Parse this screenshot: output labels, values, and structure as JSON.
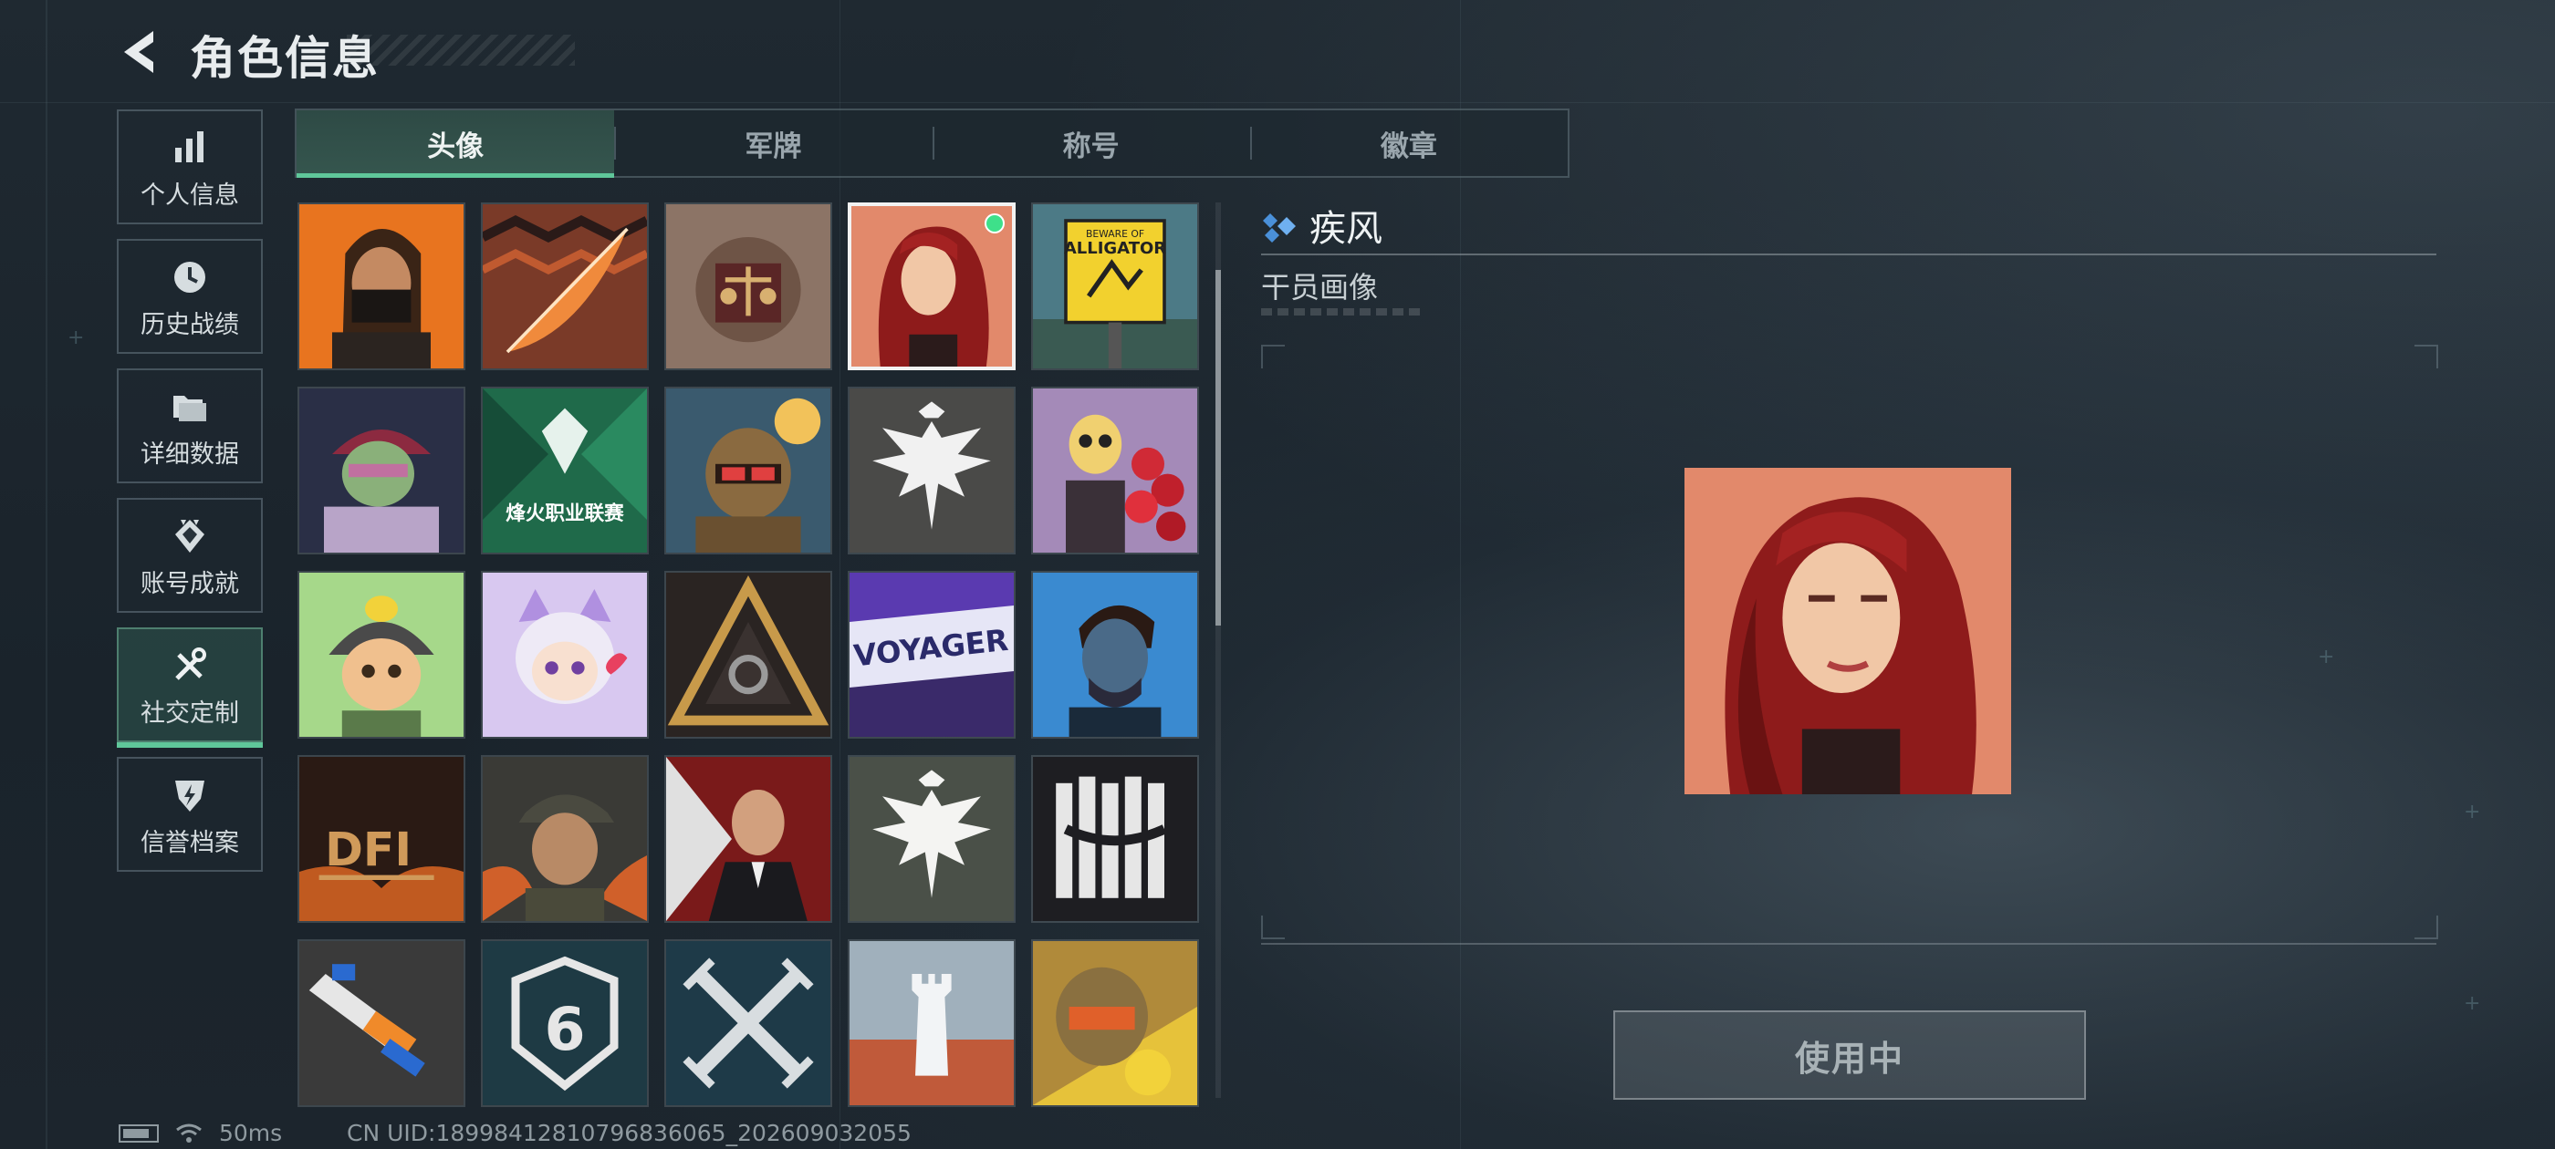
{
  "header": {
    "title": "角色信息"
  },
  "sidebar": {
    "items": [
      {
        "label": "个人信息",
        "icon": "bar-chart-icon",
        "active": false
      },
      {
        "label": "历史战绩",
        "icon": "clock-icon",
        "active": false
      },
      {
        "label": "详细数据",
        "icon": "folder-icon",
        "active": false
      },
      {
        "label": "账号成就",
        "icon": "badge-icon",
        "active": false
      },
      {
        "label": "社交定制",
        "icon": "tools-icon",
        "active": true
      },
      {
        "label": "信誉档案",
        "icon": "shield-bolt-icon",
        "active": false
      }
    ]
  },
  "tabs": [
    {
      "label": "头像",
      "active": true
    },
    {
      "label": "军牌",
      "active": false
    },
    {
      "label": "称号",
      "active": false
    },
    {
      "label": "徽章",
      "active": false
    }
  ],
  "avatars": [
    {
      "name": "masked-man-avatar",
      "text": ""
    },
    {
      "name": "feather-avatar",
      "text": ""
    },
    {
      "name": "scales-emblem-avatar",
      "text": ""
    },
    {
      "name": "red-hair-woman-avatar",
      "text": "",
      "selected": true
    },
    {
      "name": "beware-alligator-avatar",
      "text": "BEWARE OF ALLIGATOR"
    },
    {
      "name": "zombie-soldier-avatar",
      "text": ""
    },
    {
      "name": "league-avatar",
      "text": "烽火职业联赛"
    },
    {
      "name": "robot-soldier-avatar",
      "text": ""
    },
    {
      "name": "white-eagle-avatar",
      "text": ""
    },
    {
      "name": "skeleton-roses-avatar",
      "text": ""
    },
    {
      "name": "duck-helmet-kid-avatar",
      "text": ""
    },
    {
      "name": "cat-girl-avatar",
      "text": ""
    },
    {
      "name": "triangle-emblem-avatar",
      "text": ""
    },
    {
      "name": "voyager-graffiti-avatar",
      "text": "VOYAGER"
    },
    {
      "name": "blue-portrait-man-avatar",
      "text": ""
    },
    {
      "name": "dfi-avatar",
      "text": "DFI"
    },
    {
      "name": "cap-soldier-avatar",
      "text": ""
    },
    {
      "name": "suit-man-avatar",
      "text": ""
    },
    {
      "name": "white-eagle-2-avatar",
      "text": ""
    },
    {
      "name": "teeth-bars-avatar",
      "text": ""
    },
    {
      "name": "toy-gun-avatar",
      "text": ""
    },
    {
      "name": "six-shield-avatar",
      "text": "6"
    },
    {
      "name": "crossed-swords-avatar",
      "text": ""
    },
    {
      "name": "tower-avatar",
      "text": ""
    },
    {
      "name": "gold-helmet-avatar",
      "text": ""
    }
  ],
  "detail": {
    "name": "疾风",
    "subtitle": "干员画像",
    "use_button": "使用中"
  },
  "footer": {
    "ping": "50ms",
    "uid": "CN UID:18998412810796836065_202609032055"
  },
  "colors": {
    "accent": "#5fc79a",
    "selected_dot": "#3ee08a",
    "name_icon": "#4a90d9"
  }
}
